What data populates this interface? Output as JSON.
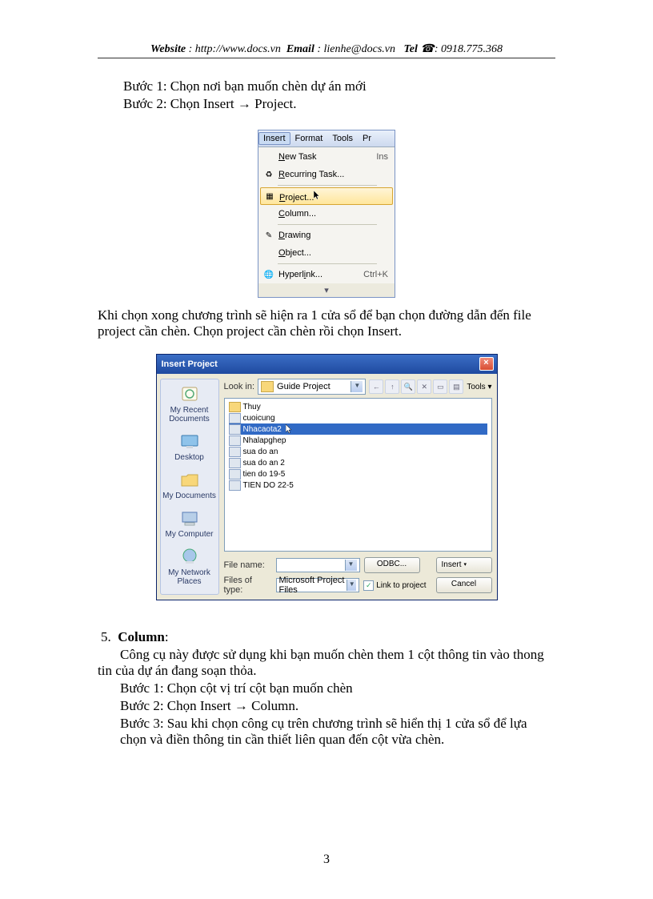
{
  "header": {
    "website_label": "Website",
    "website_sep": " : ",
    "website_value": "http://www.docs.vn",
    "email_label": "Email",
    "email_sep": "  : ",
    "email_value": "lienhe@docs.vn",
    "tel_label": "Tel",
    "tel_icon": "☎",
    "tel_sep": ": ",
    "tel_value": "0918.775.368"
  },
  "steps_a": {
    "s1": "Bước 1: Chọn nơi bạn muốn chèn dự án mới",
    "s2_pre": "Bước 2: Chọn Insert ",
    "s2_arrow": "→",
    "s2_post": " Project."
  },
  "menu": {
    "bar": {
      "insert": "Insert",
      "format": "Format",
      "tools": "Tools",
      "pr": "Pr"
    },
    "items": {
      "new_task": "New Task",
      "new_task_sc": "Ins",
      "recurring": "Recurring Task...",
      "project": "Project...",
      "column": "Column...",
      "drawing": "Drawing",
      "object": "Object...",
      "hyperlink": "Hyperlink...",
      "hyperlink_sc": "Ctrl+K"
    },
    "expand": "▾"
  },
  "paragraph1": "Khi chọn xong chương trình sẽ hiện ra 1 cửa sổ để bạn chọn đường dẫn đến file project cần chèn. Chọn project cần chèn rồi chọn Insert.",
  "dialog": {
    "title": "Insert Project",
    "close": "×",
    "lookin_label": "Look in:",
    "lookin_value": "Guide Project",
    "tools_label": "Tools",
    "places": {
      "recent": "My Recent Documents",
      "desktop": "Desktop",
      "mydocs": "My Documents",
      "mycomp": "My Computer",
      "network": "My Network Places"
    },
    "files": [
      {
        "icon": "folder",
        "name": "Thuy"
      },
      {
        "icon": "proj",
        "name": "cuoicung"
      },
      {
        "icon": "proj",
        "name": "Nhacaota2",
        "sel": true
      },
      {
        "icon": "proj",
        "name": "Nhalapghep"
      },
      {
        "icon": "proj",
        "name": "sua do an"
      },
      {
        "icon": "proj",
        "name": "sua do an 2"
      },
      {
        "icon": "proj",
        "name": "tien do 19-5"
      },
      {
        "icon": "proj",
        "name": "TIEN DO 22-5"
      }
    ],
    "filename_label": "File name:",
    "filetype_label": "Files of type:",
    "filetype_value": "Microsoft Project Files",
    "odbc": "ODBC...",
    "link": "Link to project",
    "insert": "Insert",
    "cancel": "Cancel",
    "insert_arrow": "▾"
  },
  "section5": {
    "num": "5.",
    "title": "Column",
    "colon": ":",
    "p1": "Công cụ này được sử dụng khi bạn muốn chèn them 1 cột thông tin vào thong tin của dự án đang soạn thỏa.",
    "s1": "Bước 1:   Chọn cột vị trí cột bạn muốn chèn",
    "s2_pre": "Bước 2:   Chọn Insert ",
    "s2_arrow": "→",
    "s2_post": " Column.",
    "s3": "Bước 3:   Sau khi chọn công cụ trên chương trình sẽ hiển thị 1 cửa sổ để lựa chọn và điền thông tin cần thiết liên quan đến cột vừa chèn."
  },
  "page_number": "3"
}
